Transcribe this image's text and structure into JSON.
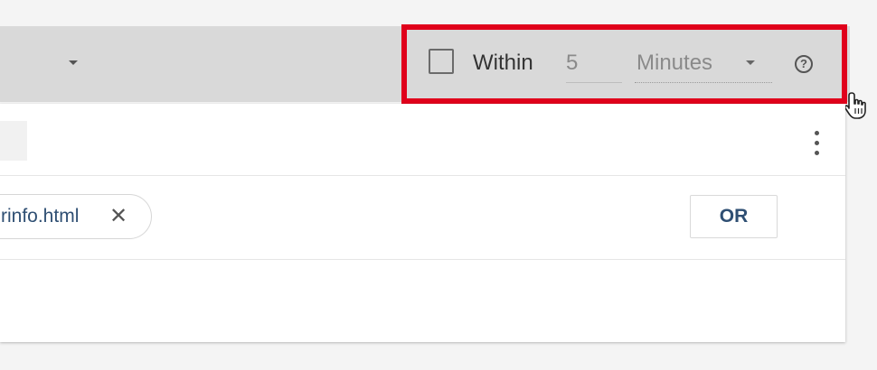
{
  "within": {
    "label": "Within",
    "value": "5",
    "unit": "Minutes",
    "help_symbol": "?"
  },
  "condition": {
    "chip_label": "rinfo.html",
    "chip_close": "✕",
    "or_button": "OR"
  },
  "colors": {
    "highlight": "#e0001b",
    "toolbar_bg": "#d9d9d9",
    "link_text": "#2f4f73"
  },
  "icons": {
    "toolbar_dropdown": "caret-down-icon",
    "unit_dropdown": "caret-down-icon",
    "help": "help-circle-icon",
    "menu": "more-vert-icon",
    "cursor": "hand-pointer-icon",
    "chip_remove": "close-icon"
  }
}
